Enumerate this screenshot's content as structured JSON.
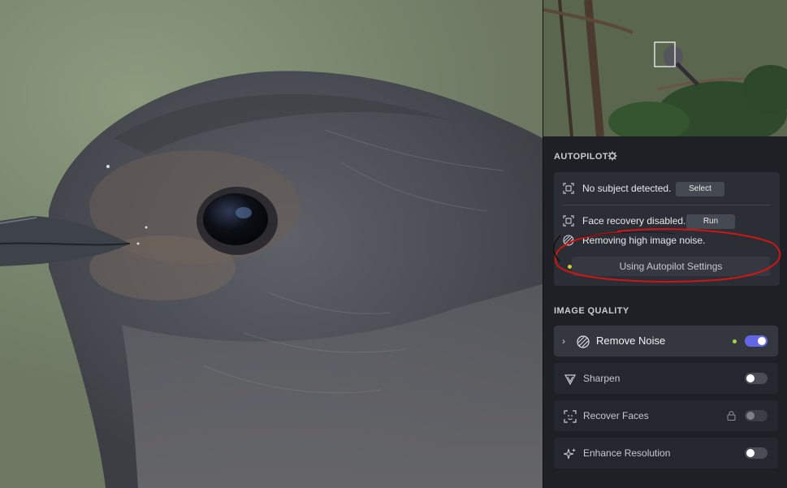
{
  "autopilot": {
    "title": "AUTOPILOT",
    "gear_icon": "gear-icon",
    "subject_status": "No subject detected.",
    "select_label": "Select",
    "face_status": "Face recovery disabled.",
    "run_label": "Run",
    "noise_status": "Removing high image noise.",
    "settings_label": "Using Autopilot Settings"
  },
  "image_quality": {
    "title": "IMAGE QUALITY",
    "items": [
      {
        "label": "Remove Noise",
        "icon": "noise-icon",
        "enabled": true,
        "expanded": false
      },
      {
        "label": "Sharpen",
        "icon": "sharpen-icon",
        "enabled": false
      },
      {
        "label": "Recover Faces",
        "icon": "face-scan-icon",
        "enabled": false,
        "locked": true
      },
      {
        "label": "Enhance Resolution",
        "icon": "sparkle-icon",
        "enabled": false
      }
    ]
  },
  "colors": {
    "accent": "#6466e8",
    "active_dot": "#9bd64a",
    "autopilot_dot": "#c8cd3a",
    "annotation": "#d01515"
  }
}
